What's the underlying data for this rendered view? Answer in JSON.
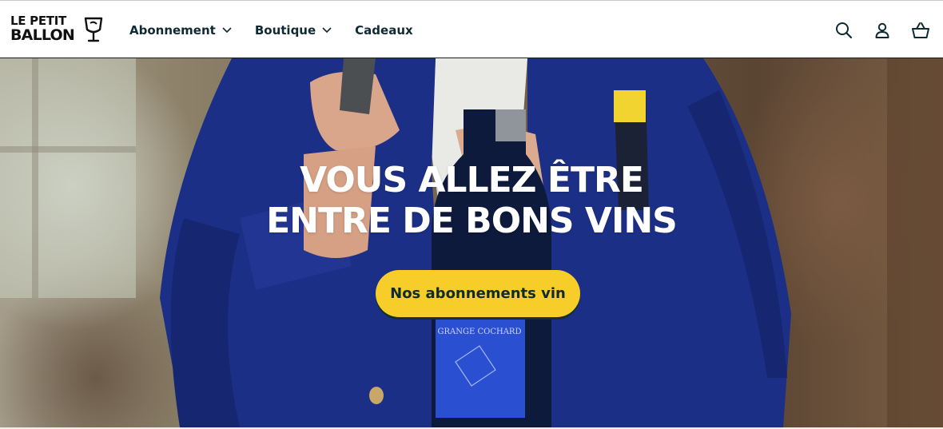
{
  "header": {
    "logo": {
      "line1": "LE PETIT",
      "line2": "BALLON"
    },
    "nav": [
      {
        "label": "Abonnement",
        "has_dropdown": true
      },
      {
        "label": "Boutique",
        "has_dropdown": true
      },
      {
        "label": "Cadeaux",
        "has_dropdown": false
      }
    ],
    "icons": [
      "search-icon",
      "account-icon",
      "basket-icon"
    ]
  },
  "hero": {
    "title_line1": "VOUS ALLEZ ÊTRE",
    "title_line2": "ENTRE DE BONS VINS",
    "cta_label": "Nos abonnements vin",
    "bottle_label": "GRANGE COCHARD"
  },
  "colors": {
    "cta_background": "#f7cd2a",
    "cta_text": "#102b2a",
    "nav_text": "#0f2a33",
    "jacket_blue": "#1c2f86"
  }
}
